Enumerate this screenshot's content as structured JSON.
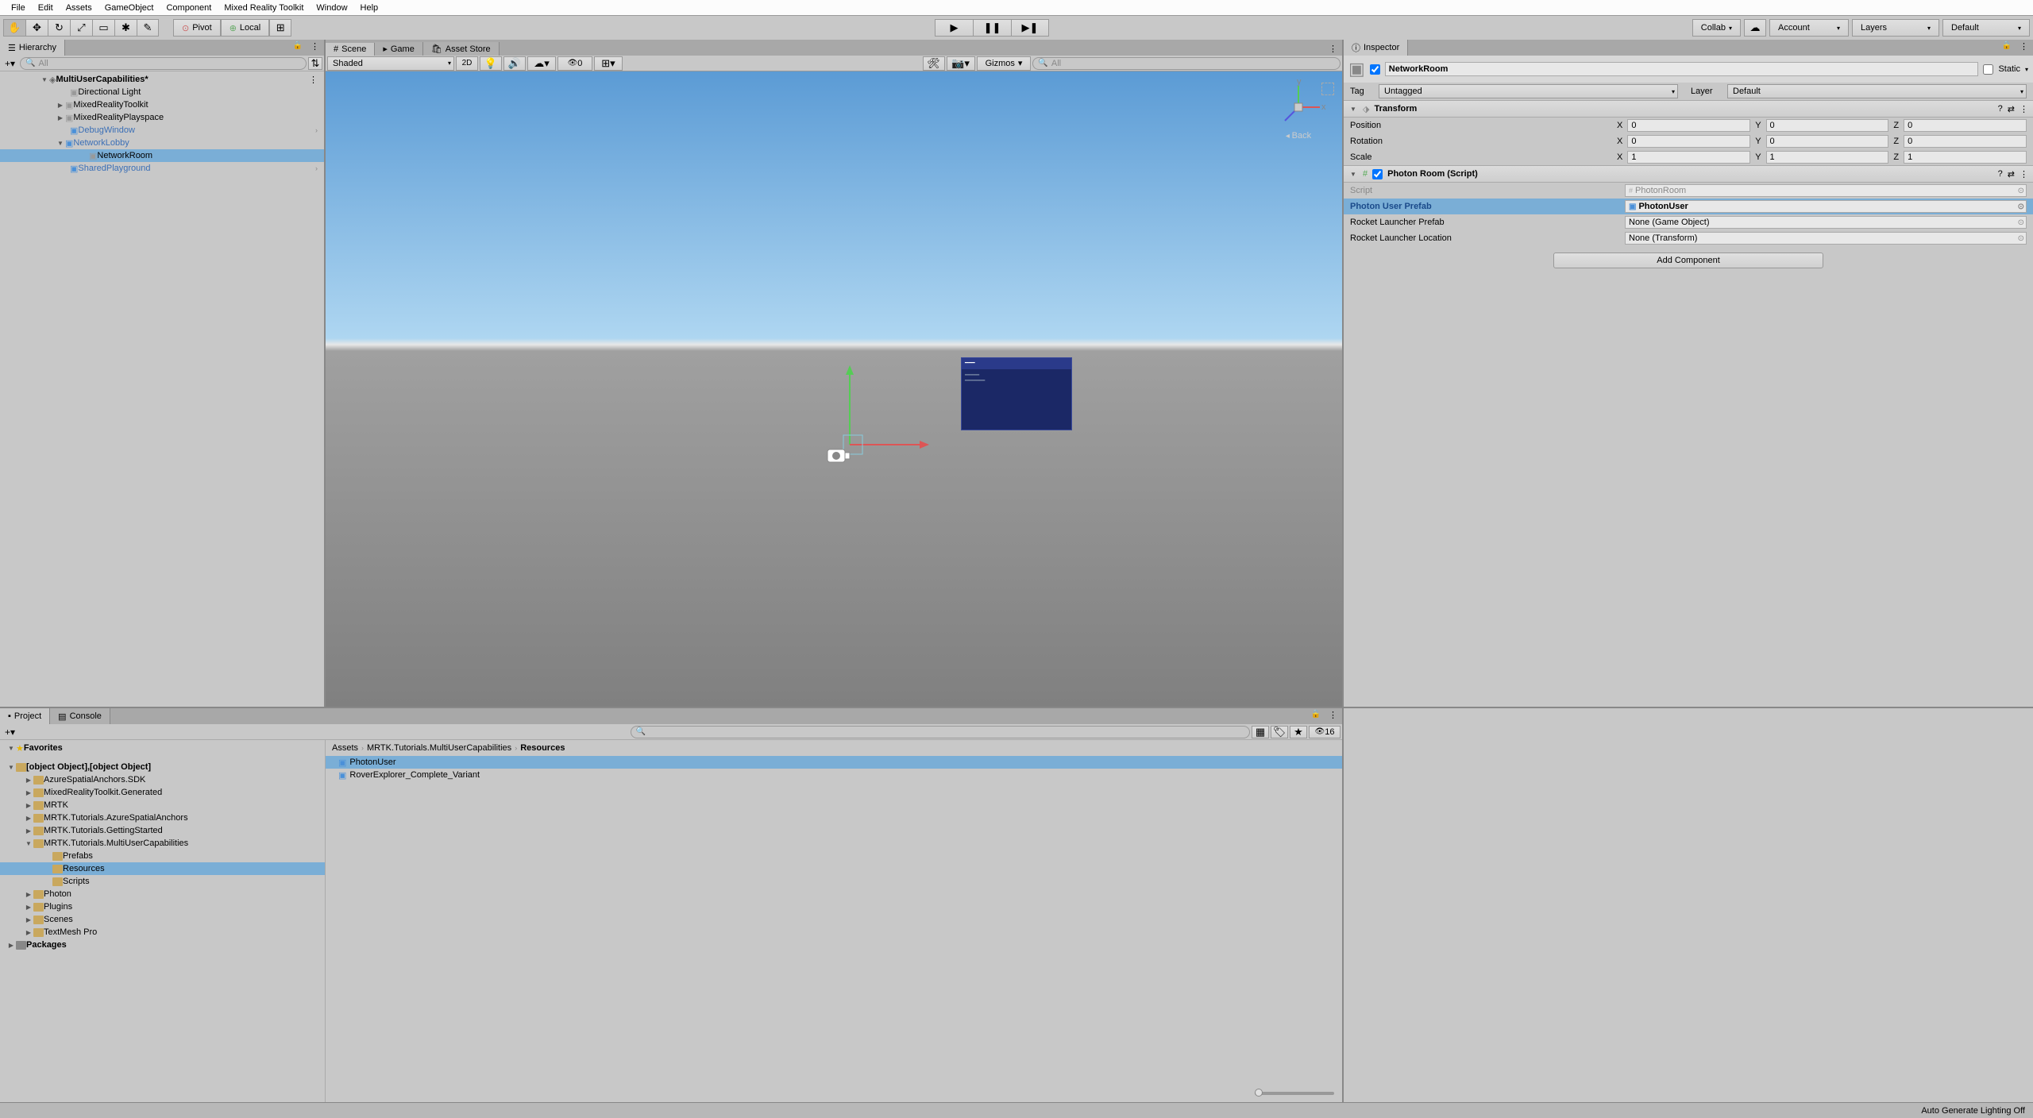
{
  "menubar": [
    "File",
    "Edit",
    "Assets",
    "GameObject",
    "Component",
    "Mixed Reality Toolkit",
    "Window",
    "Help"
  ],
  "toolbar": {
    "pivot": "Pivot",
    "local": "Local",
    "collab": "Collab",
    "account": "Account",
    "layers": "Layers",
    "layout": "Default"
  },
  "hierarchy": {
    "title": "Hierarchy",
    "search_placeholder": "All",
    "scene": "MultiUserCapabilities*",
    "items": [
      {
        "name": "Directional Light",
        "indent": 1,
        "blue": false
      },
      {
        "name": "MixedRealityToolkit",
        "indent": 1,
        "blue": false,
        "arrow": true
      },
      {
        "name": "MixedRealityPlayspace",
        "indent": 1,
        "blue": false,
        "arrow": true
      },
      {
        "name": "DebugWindow",
        "indent": 1,
        "blue": true,
        "chevron": true
      },
      {
        "name": "NetworkLobby",
        "indent": 1,
        "blue": true,
        "arrow": true,
        "open": true
      },
      {
        "name": "NetworkRoom",
        "indent": 2,
        "blue": false,
        "selected": true
      },
      {
        "name": "SharedPlayground",
        "indent": 1,
        "blue": true,
        "chevron": true
      }
    ]
  },
  "scene_tabs": {
    "scene": "Scene",
    "game": "Game",
    "asset_store": "Asset Store"
  },
  "scene_toolbar": {
    "shading": "Shaded",
    "_2d": "2D",
    "gizmos": "Gizmos",
    "zero": "0",
    "back": "Back",
    "search": "All"
  },
  "inspector": {
    "title": "Inspector",
    "name": "NetworkRoom",
    "static": "Static",
    "tag_label": "Tag",
    "tag": "Untagged",
    "layer_label": "Layer",
    "layer": "Default",
    "transform": {
      "title": "Transform",
      "position": {
        "label": "Position",
        "x": "0",
        "y": "0",
        "z": "0"
      },
      "rotation": {
        "label": "Rotation",
        "x": "0",
        "y": "0",
        "z": "0"
      },
      "scale": {
        "label": "Scale",
        "x": "1",
        "y": "1",
        "z": "1"
      }
    },
    "photon": {
      "title": "Photon Room (Script)",
      "script_label": "Script",
      "script": "PhotonRoom",
      "user_prefab_label": "Photon User Prefab",
      "user_prefab": "PhotonUser",
      "launcher_prefab_label": "Rocket Launcher Prefab",
      "launcher_prefab": "None (Game Object)",
      "launcher_loc_label": "Rocket Launcher Location",
      "launcher_loc": "None (Transform)"
    },
    "add_component": "Add Component"
  },
  "project": {
    "title": "Project",
    "console": "Console",
    "favorites": "Favorites",
    "assets": [
      {
        "name": "PhotonUser",
        "selected": true
      },
      {
        "name": "RoverExplorer_Complete_Variant"
      }
    ],
    "packages": "Packages",
    "folders": [
      {
        "name": "AzureSpatialAnchors.SDK",
        "indent": 1
      },
      {
        "name": "MixedRealityToolkit.Generated",
        "indent": 1
      },
      {
        "name": "MRTK",
        "indent": 1
      },
      {
        "name": "MRTK.Tutorials.AzureSpatialAnchors",
        "indent": 1
      },
      {
        "name": "MRTK.Tutorials.GettingStarted",
        "indent": 1
      },
      {
        "name": "MRTK.Tutorials.MultiUserCapabilities",
        "indent": 1,
        "open": true
      },
      {
        "name": "Prefabs",
        "indent": 2
      },
      {
        "name": "Resources",
        "indent": 2,
        "selected": true
      },
      {
        "name": "Scripts",
        "indent": 2
      },
      {
        "name": "Photon",
        "indent": 1
      },
      {
        "name": "Plugins",
        "indent": 1
      },
      {
        "name": "Scenes",
        "indent": 1
      },
      {
        "name": "TextMesh Pro",
        "indent": 1
      }
    ],
    "breadcrumb": [
      "Assets",
      "MRTK.Tutorials.MultiUserCapabilities",
      "Resources"
    ],
    "thumb_count": "16"
  },
  "statusbar": "Auto Generate Lighting Off"
}
